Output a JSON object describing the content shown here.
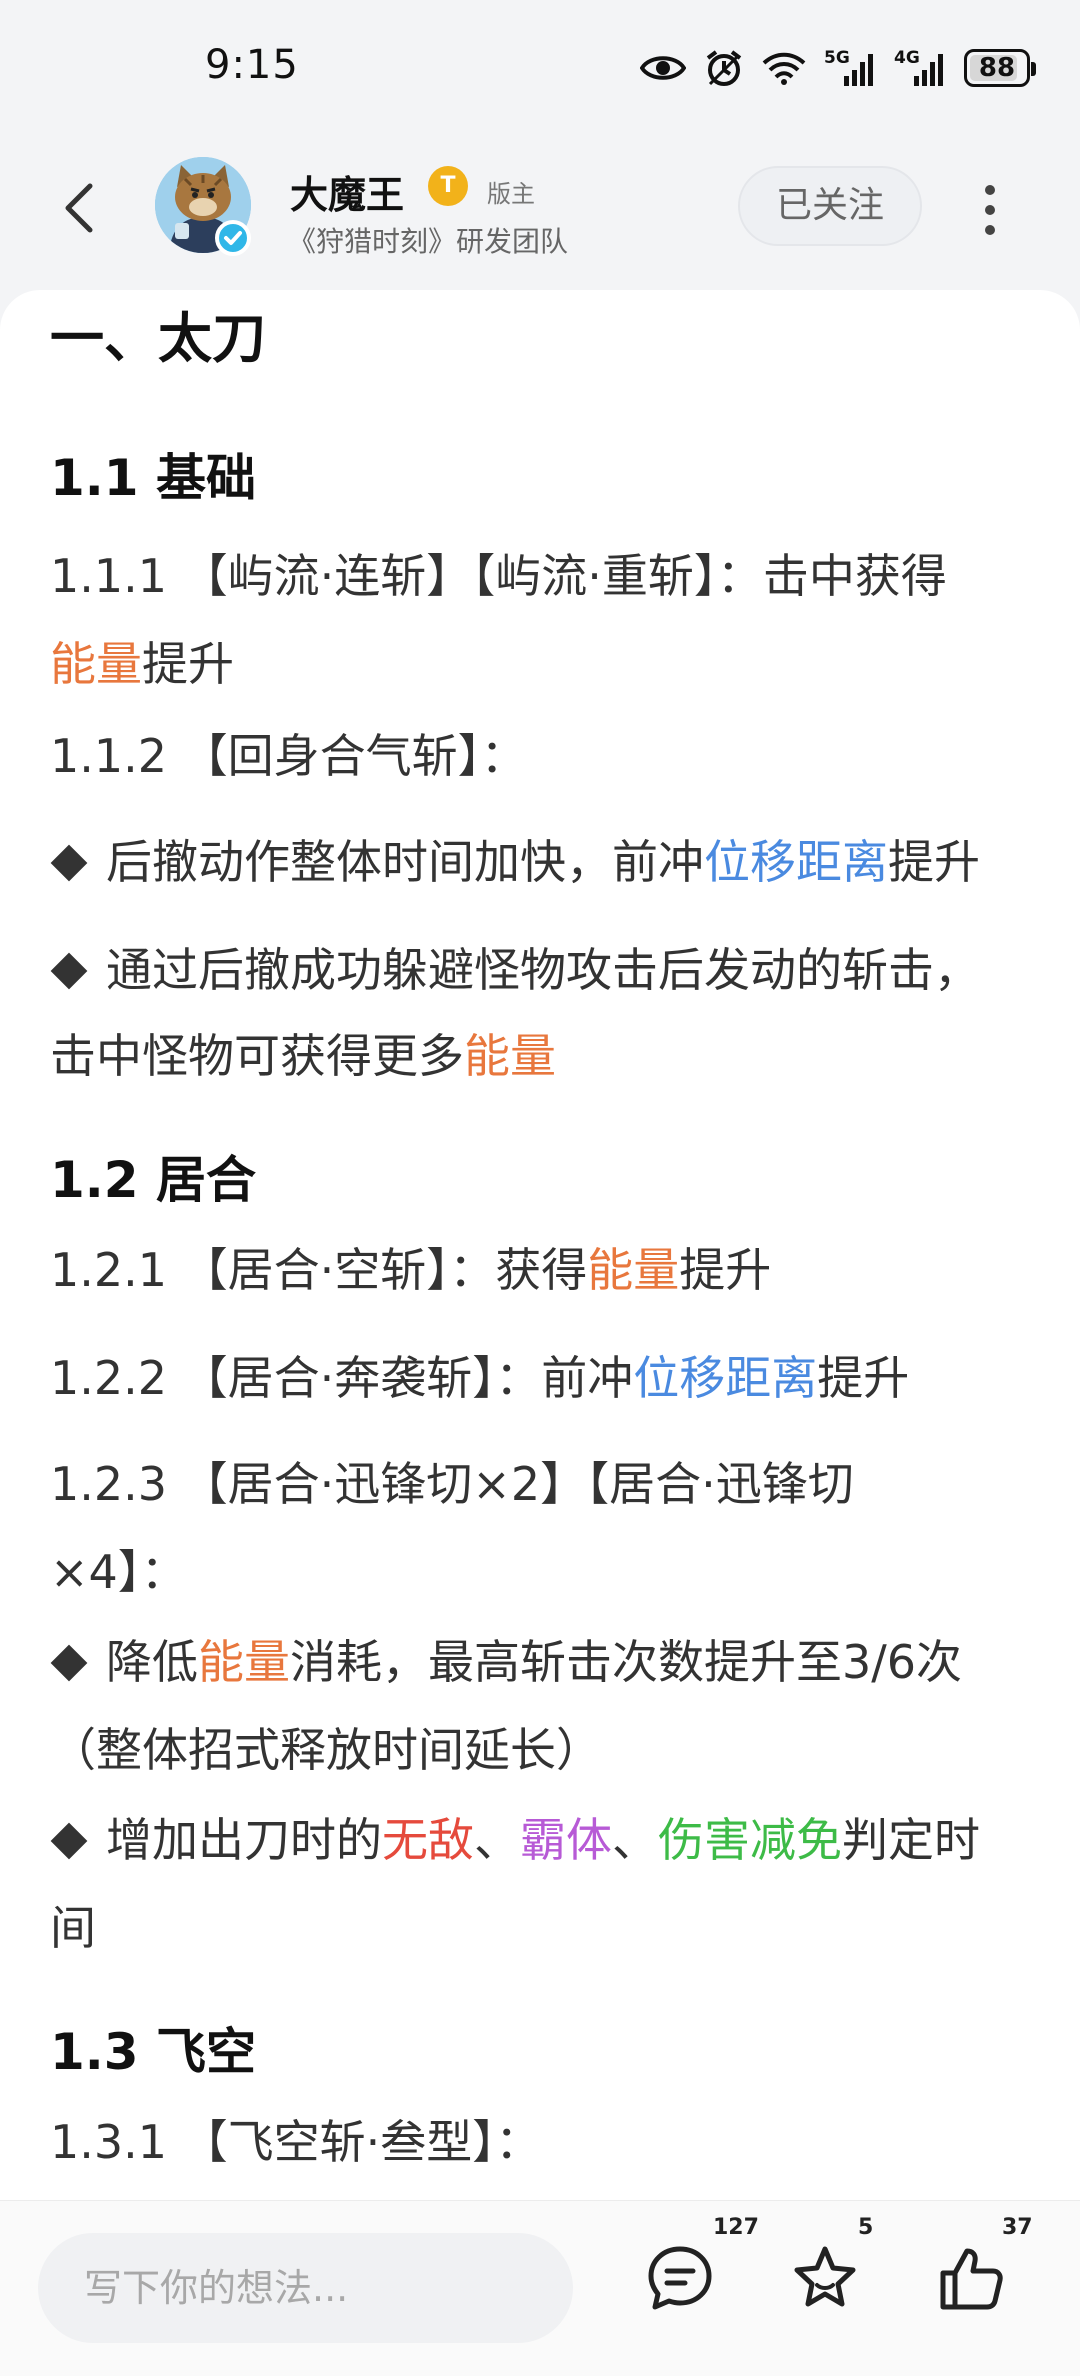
{
  "status_bar": {
    "time": "9:15",
    "signal_5g": "5G",
    "signal_4g": "4G",
    "battery": "88",
    "battery_level": 0.88,
    "icons": [
      "eye-icon",
      "alarm-icon",
      "wifi-icon",
      "signal-5g-icon",
      "signal-4g-icon",
      "battery-icon"
    ]
  },
  "header": {
    "author_name": "大魔王",
    "level_badge": "T",
    "role": "版主",
    "description": "《狩猎时刻》研发团队",
    "follow_label": "已关注"
  },
  "article": {
    "h1": "一、太刀",
    "s1_title": "1.1 基础",
    "s1_p1_a": "1.1.1 【屿流·连斩】【屿流·重斩】：击中获得",
    "s1_p1_b": "能量",
    "s1_p1_c": "提升",
    "s1_p2": "1.1.2 【回身合气斩】：",
    "s1_b1_a": "后撤动作整体时间加快，前冲",
    "s1_b1_b": "位移距离",
    "s1_b1_c": "提升",
    "s1_b2_a": "通过后撤成功躲避怪物攻击后发动的斩击，",
    "s1_b2_b": "击中怪物可获得更多",
    "s1_b2_c": "能量",
    "s2_title": "1.2 居合",
    "s2_p1_a": "1.2.1 【居合·空斩】：获得",
    "s2_p1_b": "能量",
    "s2_p1_c": "提升",
    "s2_p2_a": "1.2.2 【居合·奔袭斩】：前冲",
    "s2_p2_b": "位移距离",
    "s2_p2_c": "提升",
    "s2_p3_a": "1.2.3 【居合·迅锋切×2】【居合·迅锋切",
    "s2_p3_b": "×4】：",
    "s2_b1_a": "降低",
    "s2_b1_b": "能量",
    "s2_b1_c": "消耗，最高斩击次数提升至3/6次",
    "s2_b1_d": "（整体招式释放时间延长）",
    "s2_b2_a": "增加出刀时的",
    "s2_b2_b": "无敌",
    "s2_b2_c": "、",
    "s2_b2_d": "霸体",
    "s2_b2_e": "、",
    "s2_b2_f": "伤害减免",
    "s2_b2_g": "判定时",
    "s2_b2_h": "间",
    "s3_title": "1.3 飞空",
    "s3_p1": "1.3.1 【飞空斩·叁型】："
  },
  "bottom_bar": {
    "comment_placeholder": "写下你的想法...",
    "comments_count": "127",
    "favorites_count": "5",
    "likes_count": "37"
  },
  "colors": {
    "energy": "#e8773d",
    "displacement": "#4a8ae0",
    "invincible": "#e54a3c",
    "super_armor": "#b75ad6",
    "damage_reduction": "#3dbb47"
  }
}
